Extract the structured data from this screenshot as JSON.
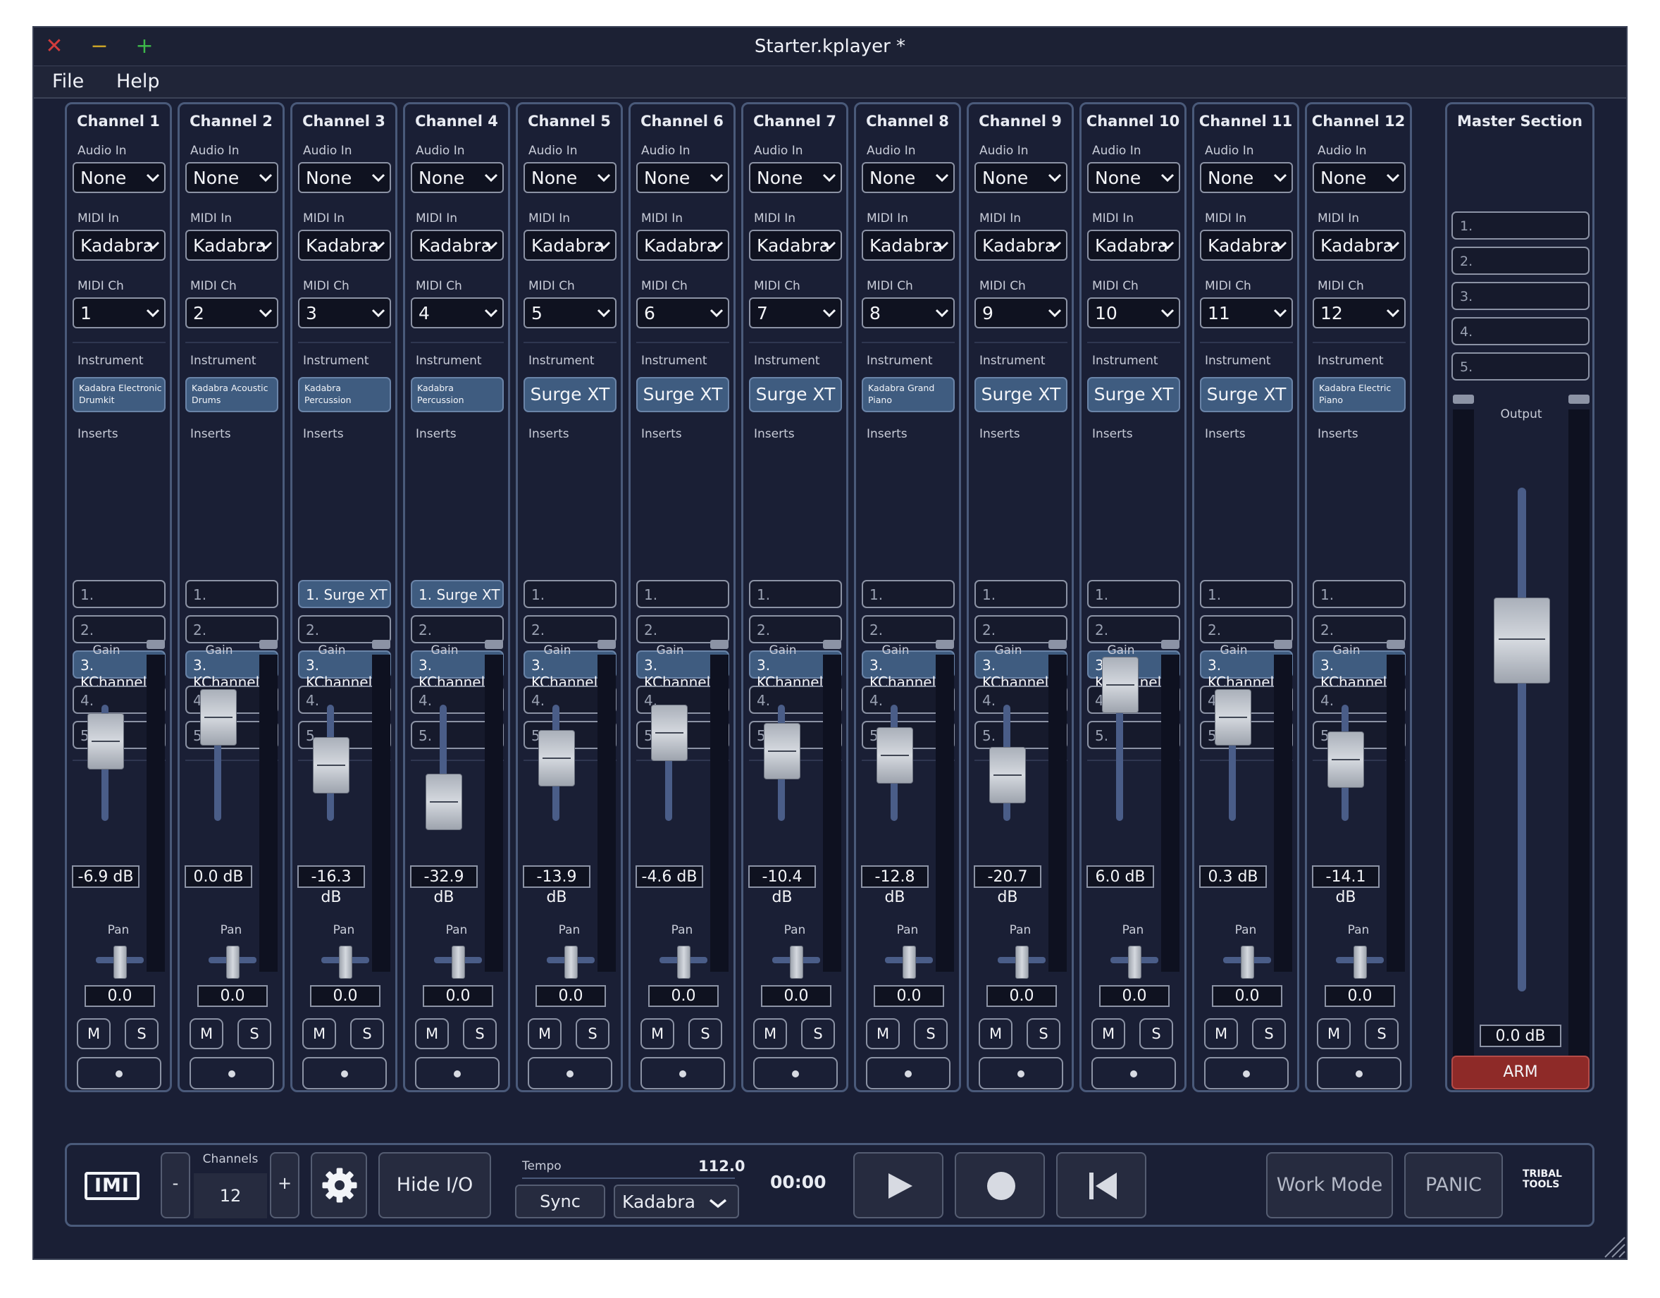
{
  "window": {
    "title": "Starter.kplayer *"
  },
  "menu": [
    "File",
    "Help"
  ],
  "labels": {
    "audio_in": "Audio In",
    "midi_in": "MIDI In",
    "midi_ch": "MIDI Ch",
    "instrument": "Instrument",
    "inserts": "Inserts",
    "gain": "Gain",
    "pan": "Pan",
    "mute": "M",
    "solo": "S"
  },
  "channels": [
    {
      "name": "Channel 1",
      "audio_in": "None",
      "midi_in": "Kadabra",
      "midi_ch": "1",
      "instrument": "Kadabra Electronic Drumkit",
      "instrument_small": true,
      "inserts": [
        "1.",
        "2.",
        "3. KChannel",
        "4.",
        "5."
      ],
      "filled": [
        false,
        false,
        true,
        false,
        false
      ],
      "gain": "-6.9 dB",
      "fader_level": 0.55,
      "pan": "0.0"
    },
    {
      "name": "Channel 2",
      "audio_in": "None",
      "midi_in": "Kadabra",
      "midi_ch": "2",
      "instrument": "Kadabra Acoustic Drums",
      "instrument_small": true,
      "inserts": [
        "1.",
        "2.",
        "3. KChannel",
        "4.",
        "5."
      ],
      "filled": [
        false,
        false,
        true,
        false,
        false
      ],
      "gain": "0.0 dB",
      "fader_level": 0.72,
      "pan": "0.0"
    },
    {
      "name": "Channel 3",
      "audio_in": "None",
      "midi_in": "Kadabra",
      "midi_ch": "3",
      "instrument": "Kadabra Percussion",
      "instrument_small": true,
      "inserts": [
        "1. Surge XT",
        "2.",
        "3. KChannel",
        "4.",
        "5."
      ],
      "filled": [
        true,
        false,
        true,
        false,
        false
      ],
      "gain": "-16.3 dB",
      "fader_level": 0.38,
      "pan": "0.0"
    },
    {
      "name": "Channel 4",
      "audio_in": "None",
      "midi_in": "Kadabra",
      "midi_ch": "4",
      "instrument": "Kadabra Percussion",
      "instrument_small": true,
      "inserts": [
        "1. Surge XT",
        "2.",
        "3. KChannel",
        "4.",
        "5."
      ],
      "filled": [
        true,
        false,
        true,
        false,
        false
      ],
      "gain": "-32.9 dB",
      "fader_level": 0.12,
      "pan": "0.0"
    },
    {
      "name": "Channel 5",
      "audio_in": "None",
      "midi_in": "Kadabra",
      "midi_ch": "5",
      "instrument": "Surge XT",
      "instrument_small": false,
      "inserts": [
        "1.",
        "2.",
        "3. KChannel",
        "4.",
        "5."
      ],
      "filled": [
        false,
        false,
        true,
        false,
        false
      ],
      "gain": "-13.9 dB",
      "fader_level": 0.43,
      "pan": "0.0"
    },
    {
      "name": "Channel 6",
      "audio_in": "None",
      "midi_in": "Kadabra",
      "midi_ch": "6",
      "instrument": "Surge XT",
      "instrument_small": false,
      "inserts": [
        "1.",
        "2.",
        "3. KChannel",
        "4.",
        "5."
      ],
      "filled": [
        false,
        false,
        true,
        false,
        false
      ],
      "gain": "-4.6 dB",
      "fader_level": 0.61,
      "pan": "0.0"
    },
    {
      "name": "Channel 7",
      "audio_in": "None",
      "midi_in": "Kadabra",
      "midi_ch": "7",
      "instrument": "Surge XT",
      "instrument_small": false,
      "inserts": [
        "1.",
        "2.",
        "3. KChannel",
        "4.",
        "5."
      ],
      "filled": [
        false,
        false,
        true,
        false,
        false
      ],
      "gain": "-10.4 dB",
      "fader_level": 0.48,
      "pan": "0.0"
    },
    {
      "name": "Channel 8",
      "audio_in": "None",
      "midi_in": "Kadabra",
      "midi_ch": "8",
      "instrument": "Kadabra Grand Piano",
      "instrument_small": true,
      "inserts": [
        "1.",
        "2.",
        "3. KChannel",
        "4.",
        "5."
      ],
      "filled": [
        false,
        false,
        true,
        false,
        false
      ],
      "gain": "-12.8 dB",
      "fader_level": 0.45,
      "pan": "0.0"
    },
    {
      "name": "Channel 9",
      "audio_in": "None",
      "midi_in": "Kadabra",
      "midi_ch": "9",
      "instrument": "Surge XT",
      "instrument_small": false,
      "inserts": [
        "1.",
        "2.",
        "3. KChannel",
        "4.",
        "5."
      ],
      "filled": [
        false,
        false,
        true,
        false,
        false
      ],
      "gain": "-20.7 dB",
      "fader_level": 0.31,
      "pan": "0.0"
    },
    {
      "name": "Channel 10",
      "audio_in": "None",
      "midi_in": "Kadabra",
      "midi_ch": "10",
      "instrument": "Surge XT",
      "instrument_small": false,
      "inserts": [
        "1.",
        "2.",
        "3. KChannel",
        "4.",
        "5."
      ],
      "filled": [
        false,
        false,
        true,
        false,
        false
      ],
      "gain": "6.0 dB",
      "fader_level": 0.95,
      "pan": "0.0"
    },
    {
      "name": "Channel 11",
      "audio_in": "None",
      "midi_in": "Kadabra",
      "midi_ch": "11",
      "instrument": "Surge XT",
      "instrument_small": false,
      "inserts": [
        "1.",
        "2.",
        "3. KChannel",
        "4.",
        "5."
      ],
      "filled": [
        false,
        false,
        true,
        false,
        false
      ],
      "gain": "0.3 dB",
      "fader_level": 0.72,
      "pan": "0.0"
    },
    {
      "name": "Channel 12",
      "audio_in": "None",
      "midi_in": "Kadabra",
      "midi_ch": "12",
      "instrument": "Kadabra Electric Piano",
      "instrument_small": true,
      "inserts": [
        "1.",
        "2.",
        "3. KChannel",
        "4.",
        "5."
      ],
      "filled": [
        false,
        false,
        true,
        false,
        false
      ],
      "gain": "-14.1 dB",
      "fader_level": 0.42,
      "pan": "0.0"
    }
  ],
  "master": {
    "title": "Master Section",
    "inserts": [
      "1.",
      "2.",
      "3.",
      "4.",
      "5."
    ],
    "output_label": "Output",
    "output": "0.0 dB",
    "arm_label": "ARM"
  },
  "transport": {
    "logo": "IMI",
    "channels_label": "Channels",
    "channels_value": "12",
    "minus": "-",
    "plus": "+",
    "hide_io": "Hide I/O",
    "tempo_label": "Tempo",
    "tempo_value": "112.0",
    "sync": "Sync",
    "sync_source": "Kadabra",
    "time": "00:00",
    "work_mode": "Work Mode",
    "panic": "PANIC",
    "brand": "TRIBAL TOOLS"
  },
  "colors": {
    "background": "#1a1f35",
    "accent": "#3f5c80",
    "arm": "#8e2a28",
    "close": "#d23c3c",
    "minimize": "#c9a227",
    "maximize": "#3db84a"
  }
}
